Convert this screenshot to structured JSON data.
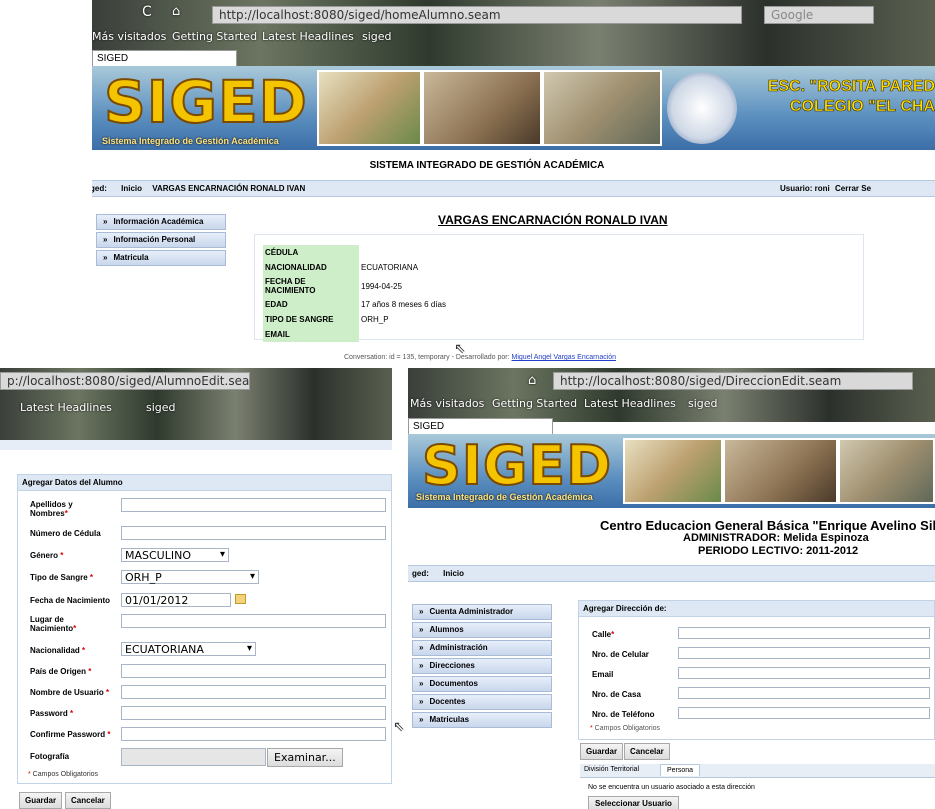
{
  "top": {
    "url": "http://localhost:8080/siged/homeAlumno.seam",
    "search_placeholder": "Google",
    "bookmarks": [
      "Más visitados",
      "Getting Started",
      "Latest Headlines",
      "siged"
    ],
    "tab": "SIGED",
    "logo": "SIGED",
    "logo_sub": "Sistema Integrado de Gestión Académica",
    "school_line1": "ESC. \"ROSITA PARED",
    "school_line2": "COLEGIO \"EL CHA",
    "system_title": "SISTEMA INTEGRADO DE GESTIÓN ACADÉMICA",
    "breadcrumb_prefix": "ged:",
    "breadcrumb_home": "Inicio",
    "breadcrumb_name": "VARGAS ENCARNACIÓN RONALD IVAN",
    "user_label": "Usuario: roni",
    "logout": "Cerrar Se",
    "menu": [
      "Información Académica",
      "Información Personal",
      "Matricula"
    ],
    "student_title": "VARGAS ENCARNACIÓN RONALD IVAN",
    "fields": [
      {
        "k": "CÉDULA",
        "v": ""
      },
      {
        "k": "NACIONALIDAD",
        "v": "ECUATORIANA"
      },
      {
        "k": "FECHA DE NACIMIENTO",
        "v": "1994-04-25"
      },
      {
        "k": "EDAD",
        "v": "17 años 8 meses 6 días"
      },
      {
        "k": "TIPO DE SANGRE",
        "v": "ORH_P"
      },
      {
        "k": "EMAIL",
        "v": ""
      }
    ],
    "footer_prefix": "Conversation: id = 135, temporary - Desarrollado por:",
    "footer_link": "Miguel Angel Vargas Encarnación"
  },
  "left": {
    "url": "p://localhost:8080/siged/AlumnoEdit.seam",
    "bookmarks": [
      "Latest Headlines",
      "siged"
    ],
    "panel_title": "Agregar Datos del Alumno",
    "labels": [
      "Apellidos y Nombres",
      "Número de Cédula",
      "Género",
      "Tipo de Sangre",
      "Fecha de Nacimiento",
      "Lugar de Nacimiento",
      "Nacionalidad",
      "País de Origen",
      "Nombre de Usuario",
      "Password",
      "Confirme Password",
      "Fotografía"
    ],
    "genero": "MASCULINO",
    "sangre": "ORH_P",
    "fecha": "01/01/2012",
    "nacionalidad": "ECUATORIANA",
    "browse": "Examinar...",
    "required_note": "Campos Obligatorios",
    "save": "Guardar",
    "cancel": "Cancelar"
  },
  "right": {
    "url": "http://localhost:8080/siged/DireccionEdit.seam",
    "bookmarks": [
      "Más visitados",
      "Getting Started",
      "Latest Headlines",
      "siged"
    ],
    "tab": "SIGED",
    "logo": "SIGED",
    "logo_sub": "Sistema Integrado de Gestión Académica",
    "center_title": "Centro Educacion General Básica \"Enrique Avelino Silva",
    "admin": "ADMINISTRADOR: Melida Espinoza",
    "periodo": "PERIODO LECTIVO: 2011-2012",
    "breadcrumb_prefix": "ged:",
    "breadcrumb_home": "Inicio",
    "menu": [
      "Cuenta Administrador",
      "Alumnos",
      "Administración",
      "Direcciones",
      "Documentos",
      "Docentes",
      "Matriculas"
    ],
    "panel_title": "Agregar Dirección de:",
    "labels": [
      "Calle",
      "Nro. de Celular",
      "Email",
      "Nro. de Casa",
      "Nro. de Teléfono"
    ],
    "required_note": "Campos Obligatorios",
    "save": "Guardar",
    "cancel": "Cancelar",
    "tabs": [
      "División Territorial",
      "Persona"
    ],
    "no_user": "No se encuentra un usuario asociado a esta dirección",
    "select_user": "Seleccionar Usuario"
  }
}
